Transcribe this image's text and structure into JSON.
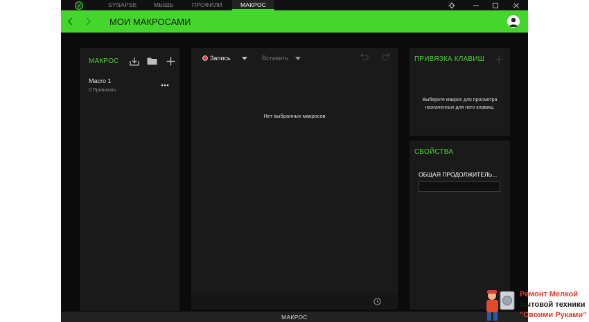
{
  "topbar": {
    "tabs": [
      {
        "label": "SYNAPSE",
        "active": false
      },
      {
        "label": "МЫШЬ",
        "active": false
      },
      {
        "label": "ПРОФИЛИ",
        "active": false
      },
      {
        "label": "МАКРОС",
        "active": true
      }
    ],
    "window_controls": [
      "gear-icon",
      "minimize-icon",
      "maximize-icon",
      "close-icon"
    ]
  },
  "header": {
    "title": "МОИ МАКРОСАМИ"
  },
  "macro_panel": {
    "title": "МАКРОС",
    "actions": [
      "import-icon",
      "folder-icon",
      "plus-icon"
    ],
    "items": [
      {
        "name": "Macro 1",
        "subtitle": "0 Привязать"
      }
    ]
  },
  "editor": {
    "record_label": "Запись",
    "insert_label": "Вставить",
    "empty_message": "Нет выбранных макросов",
    "footer_icon": "clock-icon"
  },
  "bindings_panel": {
    "title": "ПРИВЯЗКА КЛАВИШ",
    "description_line1": "Выберите макрос для просмотра",
    "description_line2": "назначенных для него клавиш."
  },
  "properties_panel": {
    "title": "СВОЙСТВА",
    "field_label": "ОБЩАЯ ПРОДОЛЖИТЕЛЬ...",
    "field_value": ""
  },
  "bottombar": {
    "label": "МАКРОС"
  },
  "watermark": {
    "line1": "Ремонт Мелкой",
    "line2": "бытовой техники",
    "line3": "\"Своими Руками\""
  },
  "colors": {
    "accent": "#44d62c",
    "background": "#0b0b0b",
    "panel": "#1a1a1a",
    "record": "#e03a3a"
  }
}
